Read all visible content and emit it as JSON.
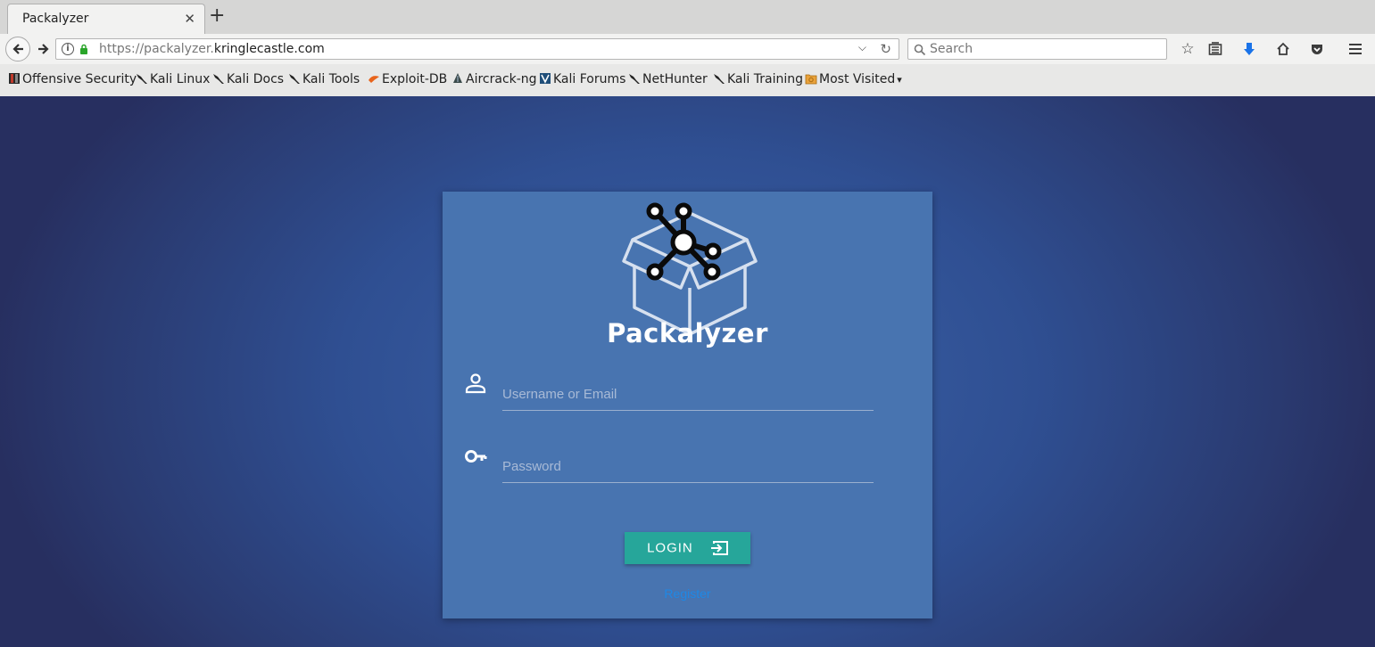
{
  "browser": {
    "tab_title": "Packalyzer",
    "url_host_prefix": "https://packalyzer.",
    "url_host_domain": "kringlecastle.com",
    "search_placeholder": "Search",
    "bookmarks": [
      {
        "label": "Offensive Security",
        "icon": "offsec-icon"
      },
      {
        "label": "Kali Linux",
        "icon": "kali-dragon-icon"
      },
      {
        "label": "Kali Docs",
        "icon": "kali-dragon-icon"
      },
      {
        "label": "Kali Tools",
        "icon": "kali-dragon-icon"
      },
      {
        "label": "Exploit-DB",
        "icon": "exploitdb-icon"
      },
      {
        "label": "Aircrack-ng",
        "icon": "aircrack-icon"
      },
      {
        "label": "Kali Forums",
        "icon": "kali-forums-icon"
      },
      {
        "label": "NetHunter",
        "icon": "kali-dragon-icon"
      },
      {
        "label": "Kali Training",
        "icon": "kali-dragon-icon"
      },
      {
        "label": "Most Visited",
        "icon": "folder-icon"
      }
    ]
  },
  "login": {
    "brand": "Packalyzer",
    "username_placeholder": "Username or Email",
    "password_placeholder": "Password",
    "login_label": "LOGIN",
    "register_label": "Register"
  },
  "colors": {
    "card": "#4874b0",
    "button": "#26a69a",
    "register_link": "#1e88e5"
  }
}
